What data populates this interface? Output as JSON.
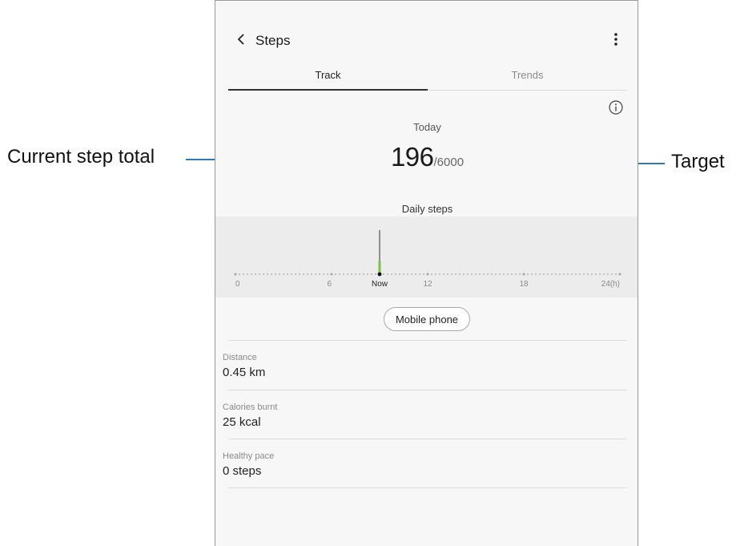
{
  "header": {
    "title": "Steps"
  },
  "tabs": [
    {
      "label": "Track",
      "active": true
    },
    {
      "label": "Trends",
      "active": false
    }
  ],
  "summary": {
    "period": "Today",
    "current": "196",
    "target": "/6000",
    "caption": "Daily steps"
  },
  "chart": {
    "x_ticks": [
      "0",
      "6",
      "Now",
      "12",
      "18",
      "24(h)"
    ],
    "now_hour": 9,
    "bar_fraction": 0.3,
    "bar_color": "#7dc242",
    "marker_color": "#333333"
  },
  "source_button": {
    "label": "Mobile phone"
  },
  "stats": [
    {
      "label": "Distance",
      "value": "0.45 km"
    },
    {
      "label": "Calories burnt",
      "value": "25 kcal"
    },
    {
      "label": "Healthy pace",
      "value": "0 steps"
    }
  ],
  "callouts": {
    "left": "Current step total",
    "right": "Target",
    "line_color": "#2f7ab4"
  },
  "icons": {
    "back": "back-arrow-icon",
    "more": "more-vertical-icon",
    "info": "info-icon"
  }
}
